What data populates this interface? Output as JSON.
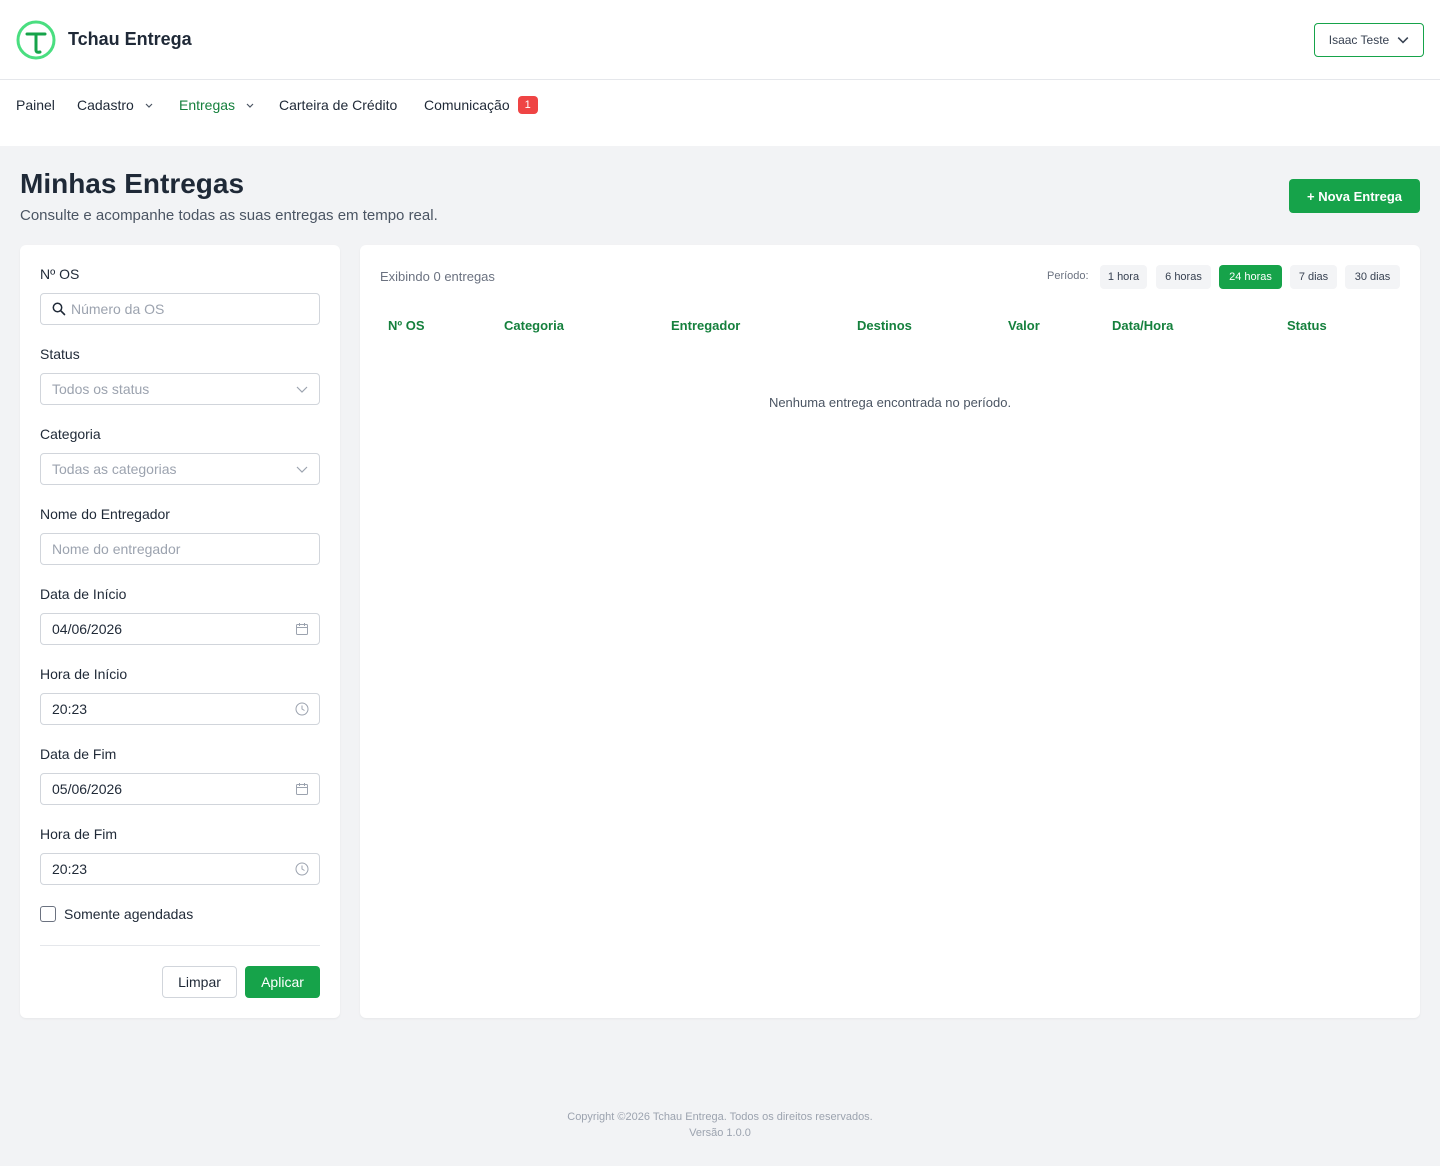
{
  "header": {
    "brand": "Tchau Entrega",
    "user_name": "Isaac Teste",
    "brand_color": "#16a34a"
  },
  "nav": {
    "painel": "Painel",
    "cadastro": "Cadastro",
    "entregas": "Entregas",
    "carteira": "Carteira de Crédito",
    "comunicacao": "Comunicação",
    "comunicacao_badge": "1"
  },
  "page": {
    "title": "Minhas Entregas",
    "subtitle": "Consulte e acompanhe todas as suas entregas em tempo real.",
    "new_button": "+ Nova Entrega"
  },
  "filters": {
    "os_label": "Nº OS",
    "os_placeholder": "Número da OS",
    "status_label": "Status",
    "status_placeholder": "Todos os status",
    "categoria_label": "Categoria",
    "categoria_placeholder": "Todas as categorias",
    "entregador_label": "Nome do Entregador",
    "entregador_placeholder": "Nome do entregador",
    "data_inicio_label": "Data de Início",
    "data_inicio_value": "04/06/2026",
    "hora_inicio_label": "Hora de Início",
    "hora_inicio_value": "20:23",
    "data_fim_label": "Data de Fim",
    "data_fim_value": "05/06/2026",
    "hora_fim_label": "Hora de Fim",
    "hora_fim_value": "20:23",
    "agendadas_label": "Somente agendadas",
    "clear_button": "Limpar",
    "apply_button": "Aplicar"
  },
  "results": {
    "count_text": "Exibindo 0 entregas",
    "period_label": "Período:",
    "periods": [
      "1 hora",
      "6 horas",
      "24 horas",
      "7 dias",
      "30 dias"
    ],
    "active_period": "24 horas",
    "columns": [
      "Nº OS",
      "Categoria",
      "Entregador",
      "Destinos",
      "Valor",
      "Data/Hora",
      "Status"
    ],
    "empty_message": "Nenhuma entrega encontrada no período."
  },
  "footer": {
    "copyright": "Copyright ©2026 Tchau Entrega. Todos os direitos reservados.",
    "version": "Versão 1.0.0"
  }
}
